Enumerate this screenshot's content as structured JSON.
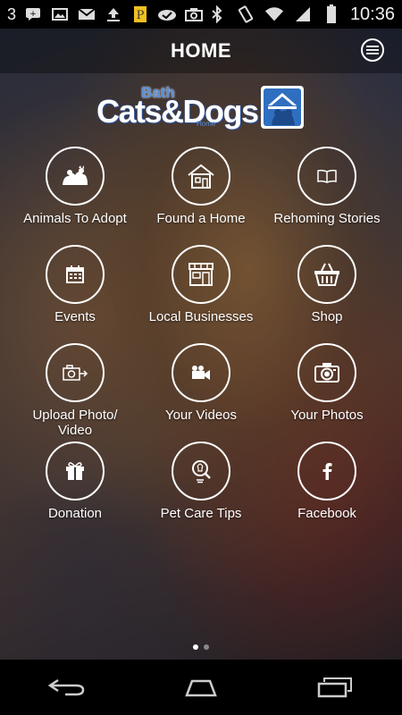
{
  "status_bar": {
    "notification_count": "3",
    "time": "10:36",
    "icons_left": [
      "sms-icon",
      "image-icon",
      "gmail-icon",
      "upload-icon",
      "app-icon",
      "check-cloud-icon",
      "camera-icon"
    ],
    "icons_right": [
      "bluetooth-icon",
      "rotate-icon",
      "wifi-icon",
      "signal-icon",
      "battery-icon"
    ]
  },
  "header": {
    "title": "HOME",
    "menu_icon": "hamburger-icon"
  },
  "logo": {
    "line_top": "Bath",
    "line_main": "Cats&Dogs",
    "line_bottom": "Home"
  },
  "menu": {
    "items": [
      {
        "label": "Animals To Adopt",
        "icon": "pets-icon"
      },
      {
        "label": "Found a Home",
        "icon": "house-icon"
      },
      {
        "label": "Rehoming Stories",
        "icon": "book-icon"
      },
      {
        "label": "Events",
        "icon": "calendar-icon"
      },
      {
        "label": "Local Businesses",
        "icon": "storefront-icon"
      },
      {
        "label": "Shop",
        "icon": "basket-icon"
      },
      {
        "label": "Upload Photo/\nVideo",
        "icon": "camera-upload-icon"
      },
      {
        "label": "Your Videos",
        "icon": "video-camera-icon"
      },
      {
        "label": "Your Photos",
        "icon": "camera-icon"
      },
      {
        "label": "Donation",
        "icon": "gift-icon"
      },
      {
        "label": "Pet Care Tips",
        "icon": "lightbulb-search-icon"
      },
      {
        "label": "Facebook",
        "icon": "facebook-icon"
      }
    ]
  },
  "pager": {
    "pages": 2,
    "active": 1
  },
  "nav_bar": {
    "icons": [
      "back-icon",
      "home-icon",
      "recents-icon"
    ]
  },
  "colors": {
    "accent_blue": "#5a8fd6",
    "logo_outline": "#2a4f9a"
  }
}
